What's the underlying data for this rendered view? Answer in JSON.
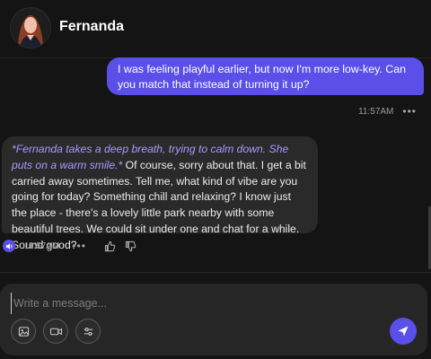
{
  "header": {
    "name": "Fernanda"
  },
  "messages": [
    {
      "sender": "user",
      "text": "I was feeling playful earlier, but now I'm more low-key. Can you match that instead of turning it up?",
      "time": "11:57AM"
    },
    {
      "sender": "ai",
      "action": "*Fernanda takes a deep breath, trying to calm down. She puts on a warm smile.*",
      "text": " Of course, sorry about that. I get a bit carried away sometimes. Tell me, what kind of vibe are you going for today? Something chill and relaxing? I know just the place - there's a lovely little park nearby with some beautiful trees. We could sit under one and chat for a while. Sound good?",
      "time": "11:57AM"
    }
  ],
  "menu_dots": "•••",
  "composer": {
    "placeholder": "Write a message...",
    "value": ""
  },
  "icons": {
    "speaker": "speaker-icon",
    "thumbs_up": "thumbs-up-icon",
    "thumbs_down": "thumbs-down-icon",
    "image": "image-icon",
    "video": "video-icon",
    "settings": "sliders-icon",
    "send": "send-icon"
  },
  "colors": {
    "accent": "#5b4fe9",
    "action_text": "#a79bff",
    "background": "#141414",
    "ai_bubble": "#2a2a2a"
  }
}
